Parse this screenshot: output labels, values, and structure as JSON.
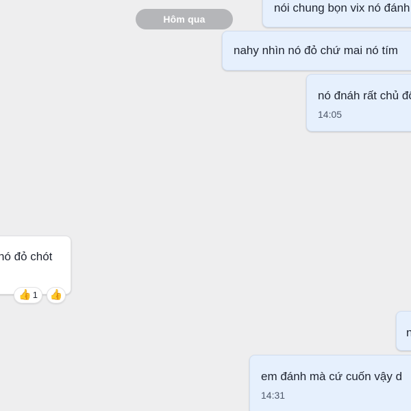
{
  "date_divider": "Hôm qua",
  "messages": [
    {
      "id": "b1",
      "direction": "outgoing",
      "text": "nói chung bọn vix nó đánh"
    },
    {
      "id": "b2",
      "direction": "outgoing",
      "text": "nahy nhìn nó đỏ chứ mai nó tím"
    },
    {
      "id": "b3",
      "direction": "outgoing",
      "text": "nó đnáh rất chủ động",
      "time": "14:05"
    },
    {
      "id": "b4",
      "direction": "incoming",
      "text": "nó đỏ chót",
      "reactions": {
        "emoji": "👍",
        "count": "1",
        "add_emoji": "👍"
      }
    },
    {
      "id": "b5",
      "direction": "outgoing",
      "text": "n"
    },
    {
      "id": "b6",
      "direction": "outgoing",
      "text": "em đánh mà cứ cuốn vậy d",
      "time": "14:31"
    }
  ],
  "colors": {
    "background": "#eeeeef",
    "outgoing_bubble": "#e6f0fd",
    "incoming_bubble": "#ffffff",
    "date_divider": "#b5b6b9",
    "reaction_emoji": "#f0b33a"
  },
  "icons": {
    "reaction": "thumbs-up-icon",
    "add_reaction": "thumbs-up-icon"
  }
}
